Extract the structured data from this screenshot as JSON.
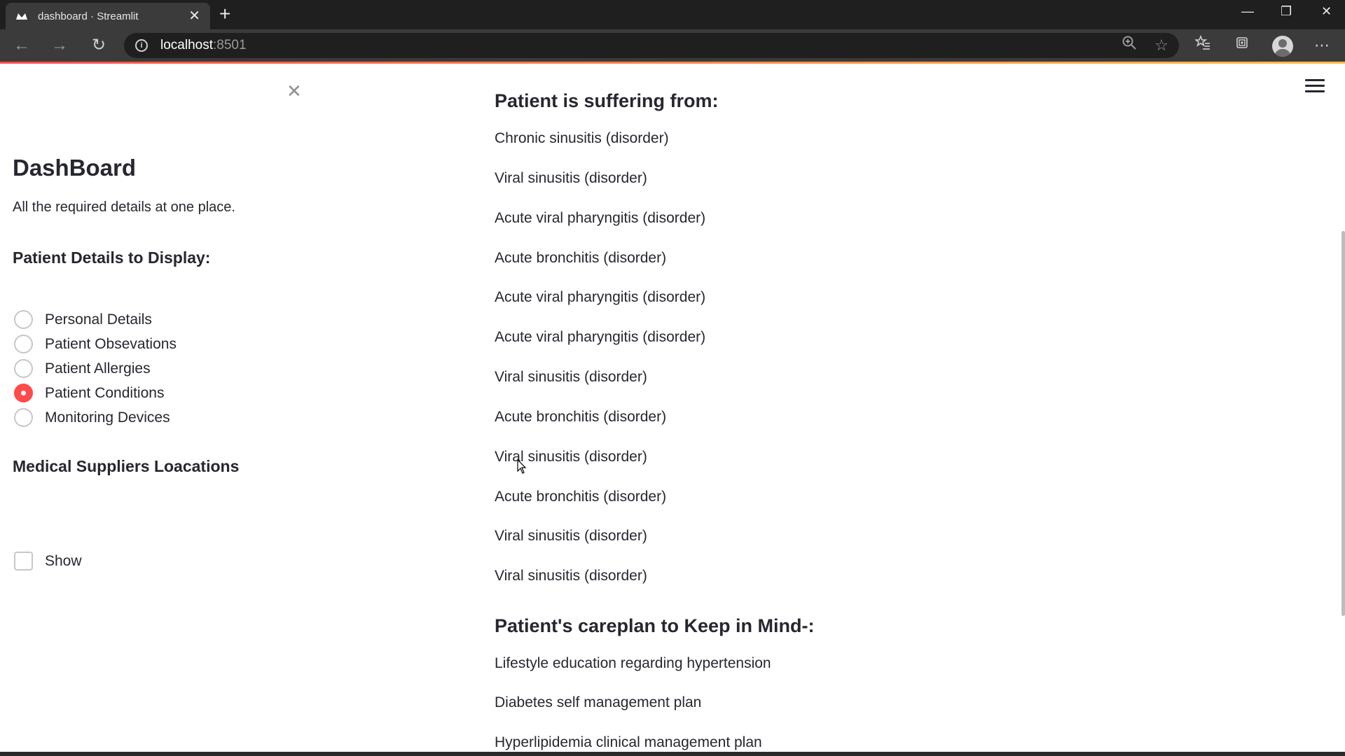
{
  "browser": {
    "tab_title": "dashboard · Streamlit",
    "tab_close": "✕",
    "new_tab": "+",
    "url_host": "localhost",
    "url_port": ":8501",
    "window_controls": [
      "—",
      "❐",
      "✕"
    ]
  },
  "sidebar": {
    "close": "✕",
    "title": "DashBoard",
    "subtitle": "All the required details at one place.",
    "radio_heading": "Patient Details to Display:",
    "radio_options": [
      {
        "label": "Personal Details",
        "selected": false
      },
      {
        "label": "Patient Obsevations",
        "selected": false
      },
      {
        "label": "Patient Allergies",
        "selected": false
      },
      {
        "label": "Patient Conditions",
        "selected": true
      },
      {
        "label": "Monitoring Devices",
        "selected": false
      }
    ],
    "suppliers_heading": "Medical Suppliers Loacations",
    "show_checkbox": {
      "label": "Show",
      "checked": false
    }
  },
  "main": {
    "conditions_heading": "Patient is suffering from:",
    "conditions": [
      "Chronic sinusitis (disorder)",
      "Viral sinusitis (disorder)",
      "Acute viral pharyngitis (disorder)",
      "Acute bronchitis (disorder)",
      "Acute viral pharyngitis (disorder)",
      "Acute viral pharyngitis (disorder)",
      "Viral sinusitis (disorder)",
      "Acute bronchitis (disorder)",
      "Viral sinusitis (disorder)",
      "Acute bronchitis (disorder)",
      "Viral sinusitis (disorder)",
      "Viral sinusitis (disorder)"
    ],
    "careplan_heading": "Patient's careplan to Keep in Mind-:",
    "careplans": [
      "Lifestyle education regarding hypertension",
      "Diabetes self management plan",
      "Hyperlipidemia clinical management plan"
    ]
  },
  "colors": {
    "accent": "#ff4b4b",
    "text": "#262730",
    "chrome_dark": "#1f1f1f",
    "chrome_mid": "#3b3b3b"
  }
}
